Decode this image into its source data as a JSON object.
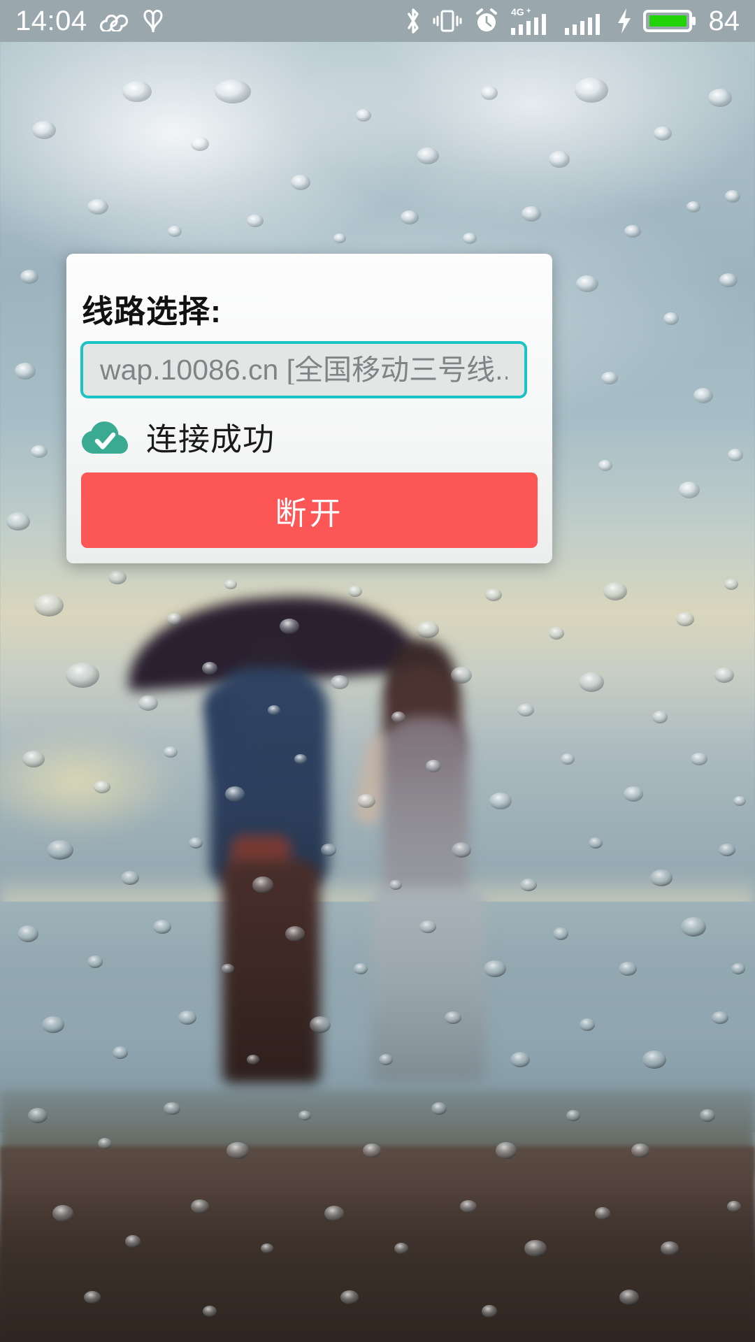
{
  "statusbar": {
    "time": "14:04",
    "battery_percent": "84",
    "left_icons": [
      {
        "name": "infinity-icon",
        "glyph": "∞"
      },
      {
        "name": "ribbon-icon",
        "glyph": "ribbon"
      }
    ],
    "right_icons": [
      {
        "name": "bluetooth-icon",
        "glyph": "bluetooth"
      },
      {
        "name": "vibrate-icon",
        "glyph": "vibrate"
      },
      {
        "name": "alarm-clock-icon",
        "glyph": "alarm"
      },
      {
        "name": "signal-4gplus-icon",
        "label": "4G+"
      },
      {
        "name": "signal-bars-icon",
        "label": ""
      },
      {
        "name": "charging-bolt-icon",
        "glyph": "bolt"
      },
      {
        "name": "battery-icon",
        "glyph": "battery"
      }
    ],
    "network_label": "4G+",
    "colors": {
      "bar_background": "#9aa8ad",
      "icon": "#ffffff",
      "battery_fill": "#22d30a"
    }
  },
  "dialog": {
    "title": "线路选择:",
    "route_select": {
      "value": "wap.10086.cn [全国移动三号线..",
      "placeholder": "wap.10086.cn [全国移动三号线..",
      "border_color": "#1bc4c4",
      "fill_color": "#e4e5e5",
      "text_color": "#808486"
    },
    "status": {
      "icon_name": "cloud-check-icon",
      "text": "连接成功",
      "icon_color": "#3aab92"
    },
    "action_button": {
      "label": "断开",
      "background_color": "#fc5656",
      "text_color": "#ffffff"
    }
  },
  "wallpaper": {
    "description": "rain-drops-on-glass-couple-umbrella-seaside"
  }
}
